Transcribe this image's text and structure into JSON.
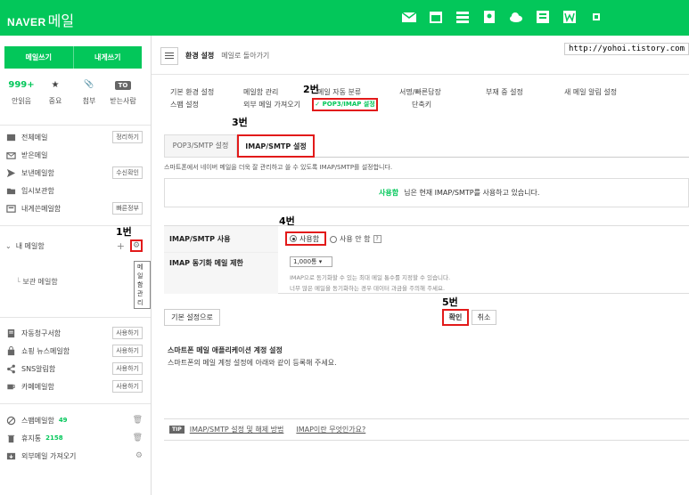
{
  "topbar": {
    "brand_naver": "NAVER",
    "brand_mail": "메일",
    "icons": [
      "mail-icon",
      "calendar-icon",
      "list-icon",
      "contacts-icon",
      "cloud-icon",
      "memo-icon",
      "office-icon",
      "more-icon"
    ]
  },
  "url": "http://yohoi.tistory.com",
  "sidebar": {
    "write_label": "메일쓰기",
    "write_self_label": "내게쓰기",
    "quick": [
      {
        "top": "999+",
        "label": "안읽음"
      },
      {
        "top": "★",
        "label": "중요"
      },
      {
        "top": "📎",
        "label": "첨부"
      },
      {
        "top": "TO",
        "label": "받는사람"
      }
    ],
    "folders": [
      {
        "label": "전체메일",
        "action": "정리하기"
      },
      {
        "label": "받은메일",
        "action": ""
      },
      {
        "label": "보낸메일함",
        "action": "수신확인"
      },
      {
        "label": "임시보관함",
        "action": ""
      },
      {
        "label": "내게쓴메일함",
        "action": "빠른정부"
      }
    ],
    "mybox_label": "내 메일함",
    "mybox_tooltip": "메일함 관리",
    "mybox_sub": "보관 메일함",
    "services": [
      {
        "label": "자동청구서함",
        "action": "사용하기"
      },
      {
        "label": "쇼핑 뉴스메일함",
        "action": "사용하기"
      },
      {
        "label": "SNS알림함",
        "action": "사용하기"
      },
      {
        "label": "카페메일함",
        "action": "사용하기"
      }
    ],
    "spam": {
      "label": "스팸메일함",
      "count": "49"
    },
    "trash": {
      "label": "휴지통",
      "count": "2158"
    },
    "external": {
      "label": "외부메일 가져오기"
    }
  },
  "steps": {
    "s1": "1번",
    "s2": "2번",
    "s3": "3번",
    "s4": "4번",
    "s5": "5번"
  },
  "main": {
    "title": "환경 설정",
    "back": "메일로 돌아가기",
    "menu": [
      "기본 환경 설정",
      "메일함 관리",
      "메일 자동 분류",
      "서명/빠른답장",
      "부재 중 설정",
      "새 메일 알림 설정",
      "스팸 설정",
      "외부 메일 가져오기",
      "POP3/IMAP 설정",
      "단축키"
    ],
    "tabs": [
      "POP3/SMTP 설정",
      "IMAP/SMTP 설정"
    ],
    "description": "스마트폰에서 네이버 메일을 더욱 잘 관리하고 쓸 수 있도록 IMAP/SMTP를 설정합니다.",
    "status_on": "사용함",
    "status_text": "님은 현재 IMAP/SMTP를 사용하고 있습니다.",
    "row1_label": "IMAP/SMTP 사용",
    "radio_on": "사용함",
    "radio_off": "사용 안 함",
    "row2_label": "IMAP 동기화 메일 제한",
    "select_value": "1,000통 ▾",
    "help1": "IMAP으로 동기화할 수 있는 최대 메일 통수를 지정할 수 있습니다.",
    "help2": "너무 많은 메일을 동기화하는 경우 데이터 과금을 주의해 주세요.",
    "btn_reset": "기본 설정으로",
    "btn_ok": "확인",
    "btn_cancel": "취소",
    "smart_title": "스마트폰 메일 애플리케이션 계정 설정",
    "smart_desc": "스마트폰의 메일 계정 설정에 아래와 같이 등록해 주세요.",
    "tip_badge": "TIP",
    "tip_link1": "IMAP/SMTP 설정 및 해제 방법",
    "tip_link2": "IMAP이란 무엇인가요?"
  }
}
